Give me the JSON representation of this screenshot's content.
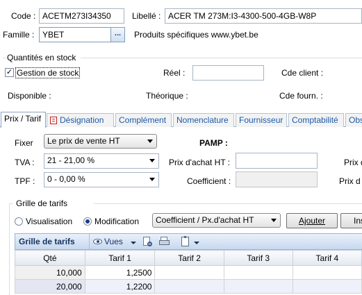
{
  "header": {
    "code_label": "Code :",
    "code_value": "ACETM273I34350",
    "libelle_label": "Libellé :",
    "libelle_value": "ACER TM 273M:I3-4300-500-4GB-W8P",
    "famille_label": "Famille :",
    "famille_value": "YBET",
    "famille_button": "...",
    "famille_description": "Produits spécifiques www.ybet.be"
  },
  "stock": {
    "group_title": "Quantités en stock",
    "gestion_label": "Gestion de stock",
    "gestion_checked": true,
    "reel_label": "Réel :",
    "reel_value": "",
    "cde_client_label": "Cde client :",
    "disponible_label": "Disponible :",
    "theorique_label": "Théorique :",
    "cde_fourn_label": "Cde fourn. :"
  },
  "tabs": [
    {
      "label": "Prix / Tarif",
      "active": true
    },
    {
      "label": "Désignation",
      "icon": "document-icon"
    },
    {
      "label": "Complément"
    },
    {
      "label": "Nomenclature"
    },
    {
      "label": "Fournisseur"
    },
    {
      "label": "Comptabilité"
    },
    {
      "label": "Obs"
    }
  ],
  "prix": {
    "fixer_label": "Fixer",
    "fixer_value": "Le prix de vente HT",
    "pamp_label": "PAMP :",
    "tva_label": "TVA :",
    "tva_value": "21 - 21,00 %",
    "prix_achat_label": "Prix d'achat HT :",
    "prix_achat_value": "",
    "prix_right_1": "Prix d",
    "tpf_label": "TPF :",
    "tpf_value": "0 - 0,00 %",
    "coefficient_label": "Coefficient :",
    "coefficient_value": "",
    "prix_right_2": "Prix d"
  },
  "grille": {
    "group_title": "Grille de tarifs",
    "radio_visualisation": "Visualisation",
    "radio_modification": "Modification",
    "mode_selected": "Modification",
    "combo_value": "Coefficient / Px.d'achat HT",
    "ajouter_button": "Ajouter",
    "ins_button": "Ins",
    "toolbar_title": "Grille de tarifs",
    "vues_label": "Vues",
    "columns": [
      "Qté",
      "Tarif 1",
      "Tarif 2",
      "Tarif 3",
      "Tarif 4"
    ],
    "rows": [
      [
        "10,000",
        "1,2500",
        "",
        "",
        ""
      ],
      [
        "20,000",
        "1,2200",
        "",
        "",
        ""
      ]
    ]
  }
}
